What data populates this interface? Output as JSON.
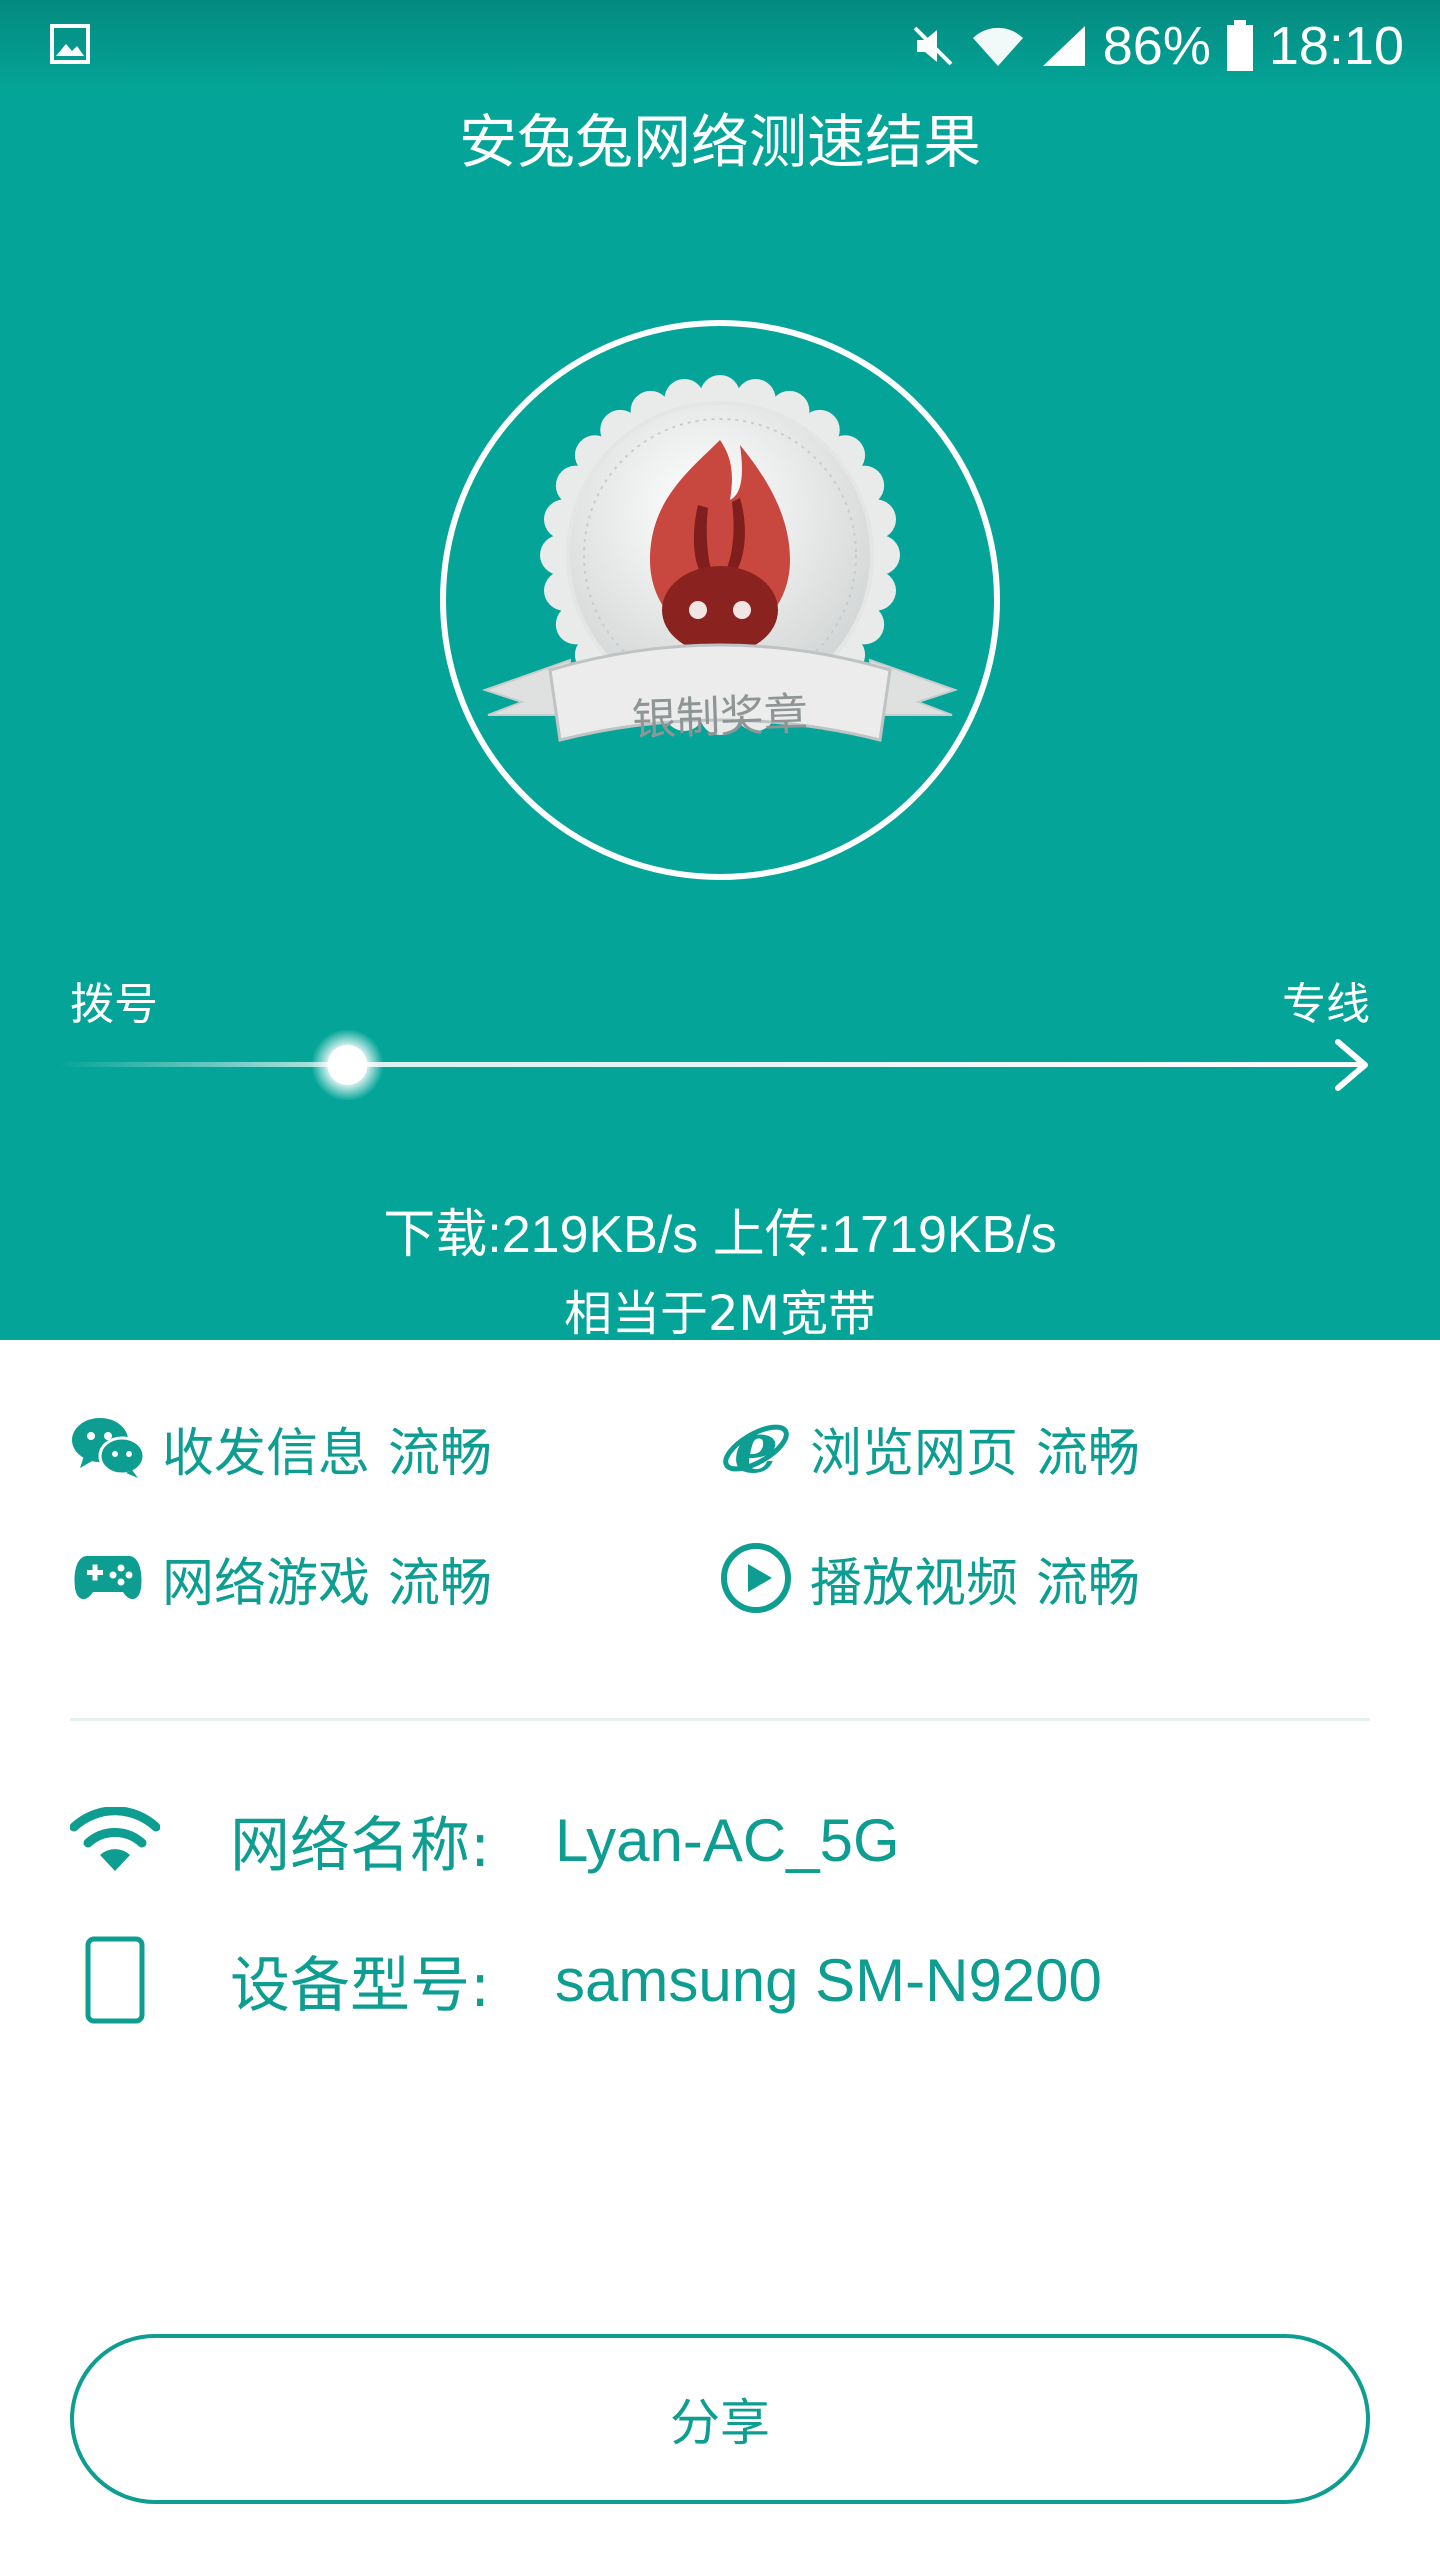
{
  "status_bar": {
    "battery": "86%",
    "time": "18:10",
    "icons": [
      "gallery-icon",
      "mute-icon",
      "wifi-icon",
      "signal-icon",
      "battery-icon"
    ]
  },
  "header": {
    "title": "安兔兔网络测速结果"
  },
  "badge": {
    "ribbon_text": "银制奖章",
    "icon": "antutu-rabbit-flame-icon"
  },
  "slider": {
    "left_label": "拨号",
    "right_label": "专线",
    "position_fraction": 0.19
  },
  "speed": {
    "line": "下载:219KB/s 上传:1719KB/s",
    "equivalent": "相当于2M宽带"
  },
  "features": [
    {
      "icon": "wechat-icon",
      "label": "收发信息",
      "status": "流畅"
    },
    {
      "icon": "ie-browser-icon",
      "label": "浏览网页",
      "status": "流畅"
    },
    {
      "icon": "gamepad-icon",
      "label": "网络游戏",
      "status": "流畅"
    },
    {
      "icon": "play-circle-icon",
      "label": "播放视频",
      "status": "流畅"
    }
  ],
  "info": {
    "network_label": "网络名称:",
    "network_value": "Lyan-AC_5G",
    "device_label": "设备型号:",
    "device_value": "samsung SM-N9200"
  },
  "share_button": {
    "label": "分享"
  },
  "colors": {
    "primary": "#04a598",
    "accent": "#0e9d91",
    "medal_red": "#c8473f"
  }
}
